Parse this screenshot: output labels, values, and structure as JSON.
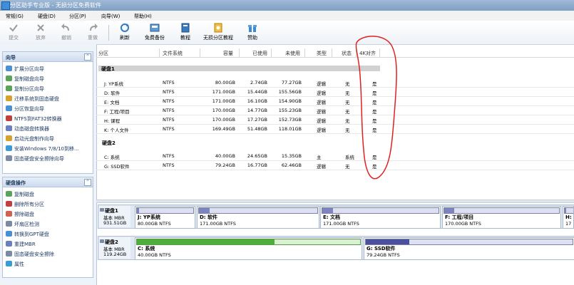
{
  "window": {
    "title": "分区助手专业版 - 无损分区免费软件"
  },
  "menu": [
    "常规(G)",
    "硬盘(D)",
    "分区(P)",
    "向导(W)",
    "帮助(H)"
  ],
  "toolbar": [
    "提交",
    "放弃",
    "撤销",
    "重做",
    "刷新",
    "免费备份",
    "教程",
    "无损分区教程",
    "赞助"
  ],
  "wizard_panel": {
    "title": "向导",
    "items": [
      "扩展分区向导",
      "复制磁盘向导",
      "复制分区向导",
      "迁移系统到固态硬盘",
      "分区恢复向导",
      "NTFS到FAT32转换器",
      "动态磁盘转换器",
      "启动光盘制作向导",
      "安装Windows 7/8/10到移...",
      "固态硬盘安全擦除向导"
    ]
  },
  "disk_panel": {
    "title": "硬盘操作",
    "items": [
      "复制磁盘",
      "删除所有分区",
      "擦除磁盘",
      "坏扇区检测",
      "转换到GPT硬盘",
      "重建MBR",
      "固态硬盘安全擦除",
      "属性"
    ]
  },
  "columns": [
    "分区",
    "文件系统",
    "容量",
    "已使用",
    "未使用",
    "类型",
    "状态",
    "4K对齐"
  ],
  "groups": [
    {
      "name": "硬盘1",
      "rows": [
        [
          "J: YP系统",
          "NTFS",
          "80.00GB",
          "2.74GB",
          "77.27GB",
          "逻辑",
          "无",
          "是"
        ],
        [
          "D: 软件",
          "NTFS",
          "171.00GB",
          "15.44GB",
          "155.56GB",
          "逻辑",
          "无",
          "是"
        ],
        [
          "E: 文档",
          "NTFS",
          "171.00GB",
          "16.10GB",
          "154.90GB",
          "逻辑",
          "无",
          "是"
        ],
        [
          "F: 工程/项目",
          "NTFS",
          "170.00GB",
          "14.77GB",
          "155.23GB",
          "逻辑",
          "无",
          "是"
        ],
        [
          "H: 课程",
          "NTFS",
          "170.00GB",
          "17.27GB",
          "152.73GB",
          "逻辑",
          "无",
          "是"
        ],
        [
          "K: 个人文件",
          "NTFS",
          "169.49GB",
          "51.48GB",
          "118.01GB",
          "逻辑",
          "无",
          "是"
        ]
      ]
    },
    {
      "name": "硬盘2",
      "rows": [
        [
          "C: 系统",
          "NTFS",
          "40.00GB",
          "24.65GB",
          "15.35GB",
          "主",
          "系统",
          "是"
        ],
        [
          "G: SSD软件",
          "NTFS",
          "79.24GB",
          "16.77GB",
          "62.46GB",
          "逻辑",
          "无",
          "是"
        ]
      ]
    }
  ],
  "disk_map": [
    {
      "name": "硬盘1",
      "type": "基本 MBR",
      "size": "931.51GB",
      "parts": [
        {
          "name": "J: YP系统",
          "size": "80.00GB NTFS",
          "used": 0.034,
          "color": "#7d84bf"
        },
        {
          "name": "D: 软件",
          "size": "171.00GB NTFS",
          "used": 0.09,
          "color": "#7d84bf"
        },
        {
          "name": "E: 文档",
          "size": "171.00GB NTFS",
          "used": 0.094,
          "color": "#7d84bf"
        },
        {
          "name": "F: 工程/项目",
          "size": "170.00GB NTFS",
          "used": 0.087,
          "color": "#7d84bf"
        },
        {
          "name": "H: 吉",
          "size": "17",
          "used": 0.1,
          "color": "#7d84bf"
        }
      ]
    },
    {
      "name": "硬盘2",
      "type": "基本 MBR",
      "size": "119.24GB",
      "parts": [
        {
          "name": "C: 系统",
          "size": "40.00GB NTFS",
          "used": 0.616,
          "color": "#4caf3a"
        },
        {
          "name": "G: SSD软件",
          "size": "79.24GB NTFS",
          "used": 0.212,
          "color": "#4a4f9e"
        }
      ]
    }
  ],
  "colors": {
    "accent": "#3c6aa8",
    "annotation": "#e02020"
  }
}
